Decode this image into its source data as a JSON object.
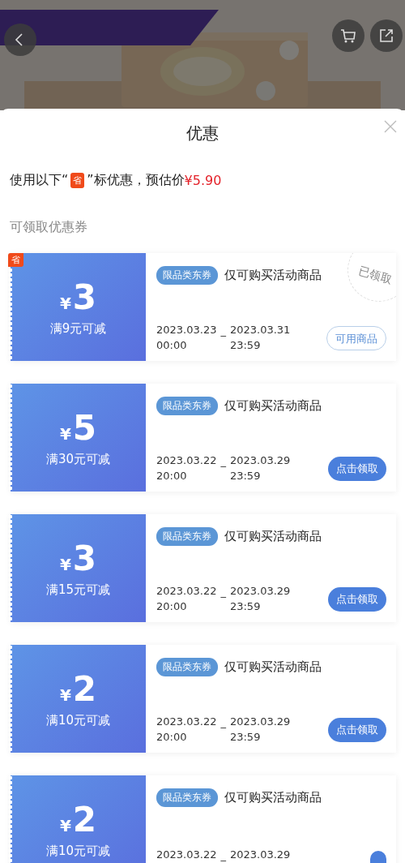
{
  "sheet": {
    "title": "优惠",
    "summary": {
      "text_before": "使用以下“",
      "badge": "省",
      "text_after": "”标优惠，预估价",
      "price": "¥5.90"
    },
    "section_label": "可领取优惠券",
    "coupons": [
      {
        "currency": "¥",
        "amount": "3",
        "condition": "满9元可减",
        "save_badge": "省",
        "tag": "限品类东券",
        "description": "仅可购买活动商品",
        "start_date": "2023.03.23",
        "start_time": "00:00",
        "separator": "_",
        "end_date": "2023.03.31",
        "end_time": "23:59",
        "button": {
          "label": "可用商品",
          "kind": "outline"
        },
        "claimed_stamp": "已领取"
      },
      {
        "currency": "¥",
        "amount": "5",
        "condition": "满30元可减",
        "tag": "限品类东券",
        "description": "仅可购买活动商品",
        "start_date": "2023.03.22",
        "start_time": "20:00",
        "separator": "_",
        "end_date": "2023.03.29",
        "end_time": "23:59",
        "button": {
          "label": "点击领取",
          "kind": "filled"
        }
      },
      {
        "currency": "¥",
        "amount": "3",
        "condition": "满15元可减",
        "tag": "限品类东券",
        "description": "仅可购买活动商品",
        "start_date": "2023.03.22",
        "start_time": "20:00",
        "separator": "_",
        "end_date": "2023.03.29",
        "end_time": "23:59",
        "button": {
          "label": "点击领取",
          "kind": "filled"
        }
      },
      {
        "currency": "¥",
        "amount": "2",
        "condition": "满10元可减",
        "tag": "限品类东券",
        "description": "仅可购买活动商品",
        "start_date": "2023.03.22",
        "start_time": "20:00",
        "separator": "_",
        "end_date": "2023.03.29",
        "end_time": "23:59",
        "button": {
          "label": "点击领取",
          "kind": "filled"
        }
      },
      {
        "currency": "¥",
        "amount": "2",
        "condition": "满10元可减",
        "tag": "限品类东券",
        "description": "仅可购买活动商品",
        "start_date": "2023.03.22",
        "separator": "_",
        "end_date": "2023.03.29",
        "button": {
          "kind": "filled"
        }
      }
    ]
  }
}
